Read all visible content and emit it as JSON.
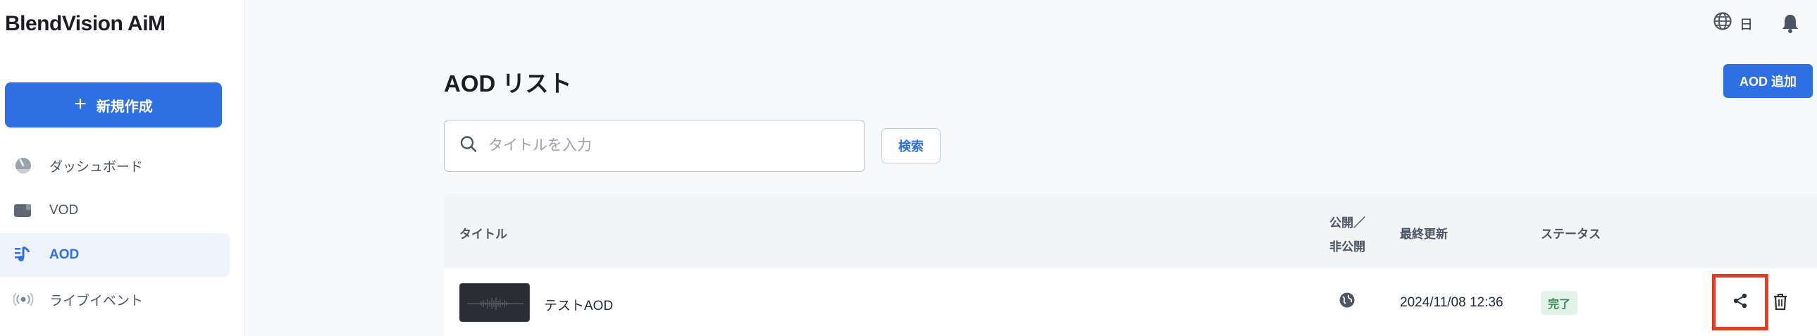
{
  "app": {
    "logo": "BlendVision AiM"
  },
  "sidebar": {
    "new_button_label": "新規作成",
    "items": [
      {
        "label": "ダッシュボード",
        "icon": "dashboard-gauge-icon"
      },
      {
        "label": "VOD",
        "icon": "video-icon"
      },
      {
        "label": "AOD",
        "icon": "music-note-icon",
        "active": true
      },
      {
        "label": "ライブイベント",
        "icon": "live-broadcast-icon"
      }
    ]
  },
  "topbar": {
    "language_label": "日",
    "language_icon": "globe-icon",
    "notification_icon": "bell-icon"
  },
  "page": {
    "title": "AOD リスト",
    "add_button_label": "AOD 追加"
  },
  "search": {
    "placeholder": "タイトルを入力",
    "value": "",
    "button_label": "検索"
  },
  "table": {
    "headers": {
      "title": "タイトル",
      "visibility_line1": "公開／",
      "visibility_line2": "非公開",
      "updated": "最終更新",
      "status": "ステータス"
    },
    "rows": [
      {
        "title": "テストAOD",
        "visibility_icon": "public-globe-icon",
        "updated": "2024/11/08 12:36",
        "status": "完了"
      }
    ]
  },
  "colors": {
    "accent": "#2f6fe4",
    "highlight_border": "#e53c23",
    "status_done_bg": "#e3f3ea",
    "status_done_text": "#2f8d57"
  }
}
